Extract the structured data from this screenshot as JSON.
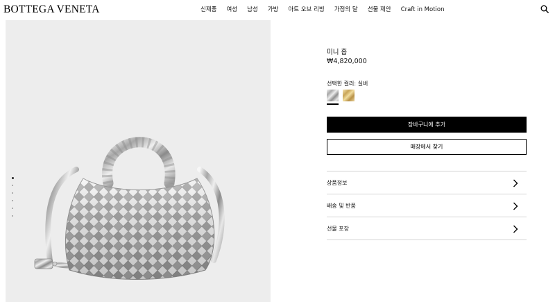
{
  "header": {
    "logo": "BOTTEGA VENETA",
    "nav": [
      {
        "label": "신제품"
      },
      {
        "label": "여성"
      },
      {
        "label": "남성"
      },
      {
        "label": "가방"
      },
      {
        "label": "아트 오브 리빙"
      },
      {
        "label": "가정의 달"
      },
      {
        "label": "선물 제안"
      },
      {
        "label": "Craft in Motion"
      }
    ],
    "search_icon": "search-icon"
  },
  "gallery": {
    "image": "silver-woven-mini-hop-bag",
    "image_count": 6,
    "active_index": 0
  },
  "product": {
    "name": "미니 홉",
    "price": "₩4,820,000",
    "color_label": "선택한 컬러: 실버",
    "swatches": [
      {
        "name": "silver",
        "color": "#c4c4c4",
        "selected": true
      },
      {
        "name": "gold",
        "color": "#d4b26a",
        "selected": false
      }
    ],
    "add_to_cart": "장바구니에 추가",
    "find_in_store": "매장에서 찾기",
    "accordion": [
      {
        "label": "상품정보",
        "icon": "chevron-right-icon"
      },
      {
        "label": "배송 및 반품",
        "icon": "chevron-right-icon"
      },
      {
        "label": "선물 포장",
        "icon": "chevron-right-icon"
      }
    ]
  }
}
